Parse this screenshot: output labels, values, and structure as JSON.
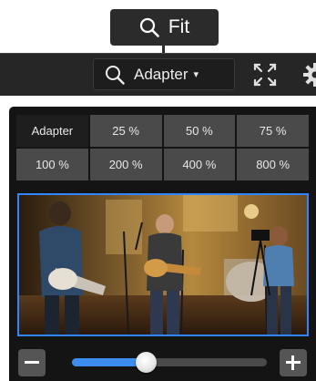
{
  "tooltip": {
    "icon": "search-icon",
    "label": "Fit"
  },
  "toolbar": {
    "zoom_select": {
      "icon": "search-icon",
      "value": "Adapter",
      "caret": "▾"
    },
    "fullscreen_icon": "fullscreen-icon",
    "settings_icon": "gear-icon"
  },
  "zoom_presets": [
    "Adapter",
    "25 %",
    "50 %",
    "75 %",
    "100 %",
    "200 %",
    "400 %",
    "800 %"
  ],
  "active_preset": "Adapter",
  "zoom_slider": {
    "level": 0.38
  },
  "colors": {
    "accent": "#3d8cf0",
    "preview_border": "#2f86ff",
    "panel_bg": "#141414",
    "toolbar_bg": "#262626"
  }
}
